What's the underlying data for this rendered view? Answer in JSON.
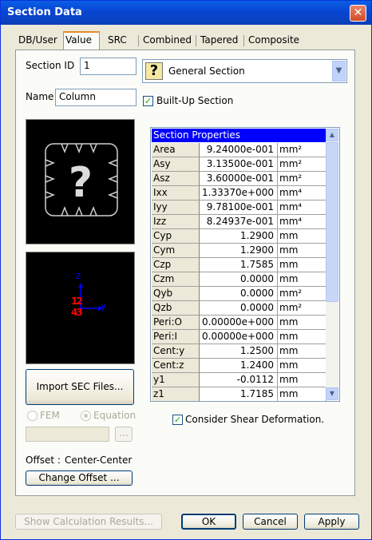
{
  "window": {
    "title": "Section Data",
    "close_glyph": "✕"
  },
  "tabs": [
    {
      "label": "DB/User",
      "active": false
    },
    {
      "label": "Value",
      "active": true
    },
    {
      "label": "SRC",
      "active": false
    },
    {
      "label": "Combined",
      "active": false
    },
    {
      "label": "Tapered",
      "active": false
    },
    {
      "label": "Composite",
      "active": false
    }
  ],
  "form": {
    "section_id_label": "Section ID",
    "section_id_value": "1",
    "name_label": "Name",
    "name_value": "Column",
    "section_type": "General Section",
    "section_type_icon": "?",
    "builtup_label": "Built-Up Section",
    "builtup_checked": true
  },
  "preview": {
    "shape_icon": "question-gear-icon",
    "axis_z": "z",
    "axis_y": "y",
    "points_top": "1 2",
    "points_bottom": "4 3"
  },
  "import_button": "Import SEC Files...",
  "radio": {
    "fem_label": "FEM",
    "equation_label": "Equation",
    "selected": "Equation"
  },
  "browse_button": "...",
  "offset": {
    "label": "Offset :",
    "value": "Center-Center",
    "change_button": "Change Offset ..."
  },
  "properties": {
    "header": "Section Properties",
    "rows": [
      {
        "name": "Area",
        "value": "9.24000e-001",
        "unit": "mm²"
      },
      {
        "name": "Asy",
        "value": "3.13500e-001",
        "unit": "mm²"
      },
      {
        "name": "Asz",
        "value": "3.60000e-001",
        "unit": "mm²"
      },
      {
        "name": "Ixx",
        "value": "1.33370e+000",
        "unit": "mm⁴"
      },
      {
        "name": "Iyy",
        "value": "9.78100e-001",
        "unit": "mm⁴"
      },
      {
        "name": "Izz",
        "value": "8.24937e-001",
        "unit": "mm⁴"
      },
      {
        "name": "Cyp",
        "value": "1.2900",
        "unit": "mm"
      },
      {
        "name": "Cym",
        "value": "1.2900",
        "unit": "mm"
      },
      {
        "name": "Czp",
        "value": "1.7585",
        "unit": "mm"
      },
      {
        "name": "Czm",
        "value": "0.0000",
        "unit": "mm"
      },
      {
        "name": "Qyb",
        "value": "0.0000",
        "unit": "mm²"
      },
      {
        "name": "Qzb",
        "value": "0.0000",
        "unit": "mm²"
      },
      {
        "name": "Peri:O",
        "value": "0.00000e+000",
        "unit": "mm"
      },
      {
        "name": "Peri:I",
        "value": "0.00000e+000",
        "unit": "mm"
      },
      {
        "name": "Cent:y",
        "value": "1.2500",
        "unit": "mm"
      },
      {
        "name": "Cent:z",
        "value": "1.2400",
        "unit": "mm"
      },
      {
        "name": "y1",
        "value": "-0.0112",
        "unit": "mm"
      },
      {
        "name": "z1",
        "value": "1.7185",
        "unit": "mm"
      }
    ]
  },
  "shear_label": "Consider Shear Deformation.",
  "shear_checked": true,
  "buttons": {
    "show_calc": "Show Calculation Results...",
    "ok": "OK",
    "cancel": "Cancel",
    "apply": "Apply"
  },
  "colors": {
    "title_bar": "#0a5fe6",
    "grid_header": "#0000ff",
    "active_tab_accent": "#e68b2c"
  }
}
